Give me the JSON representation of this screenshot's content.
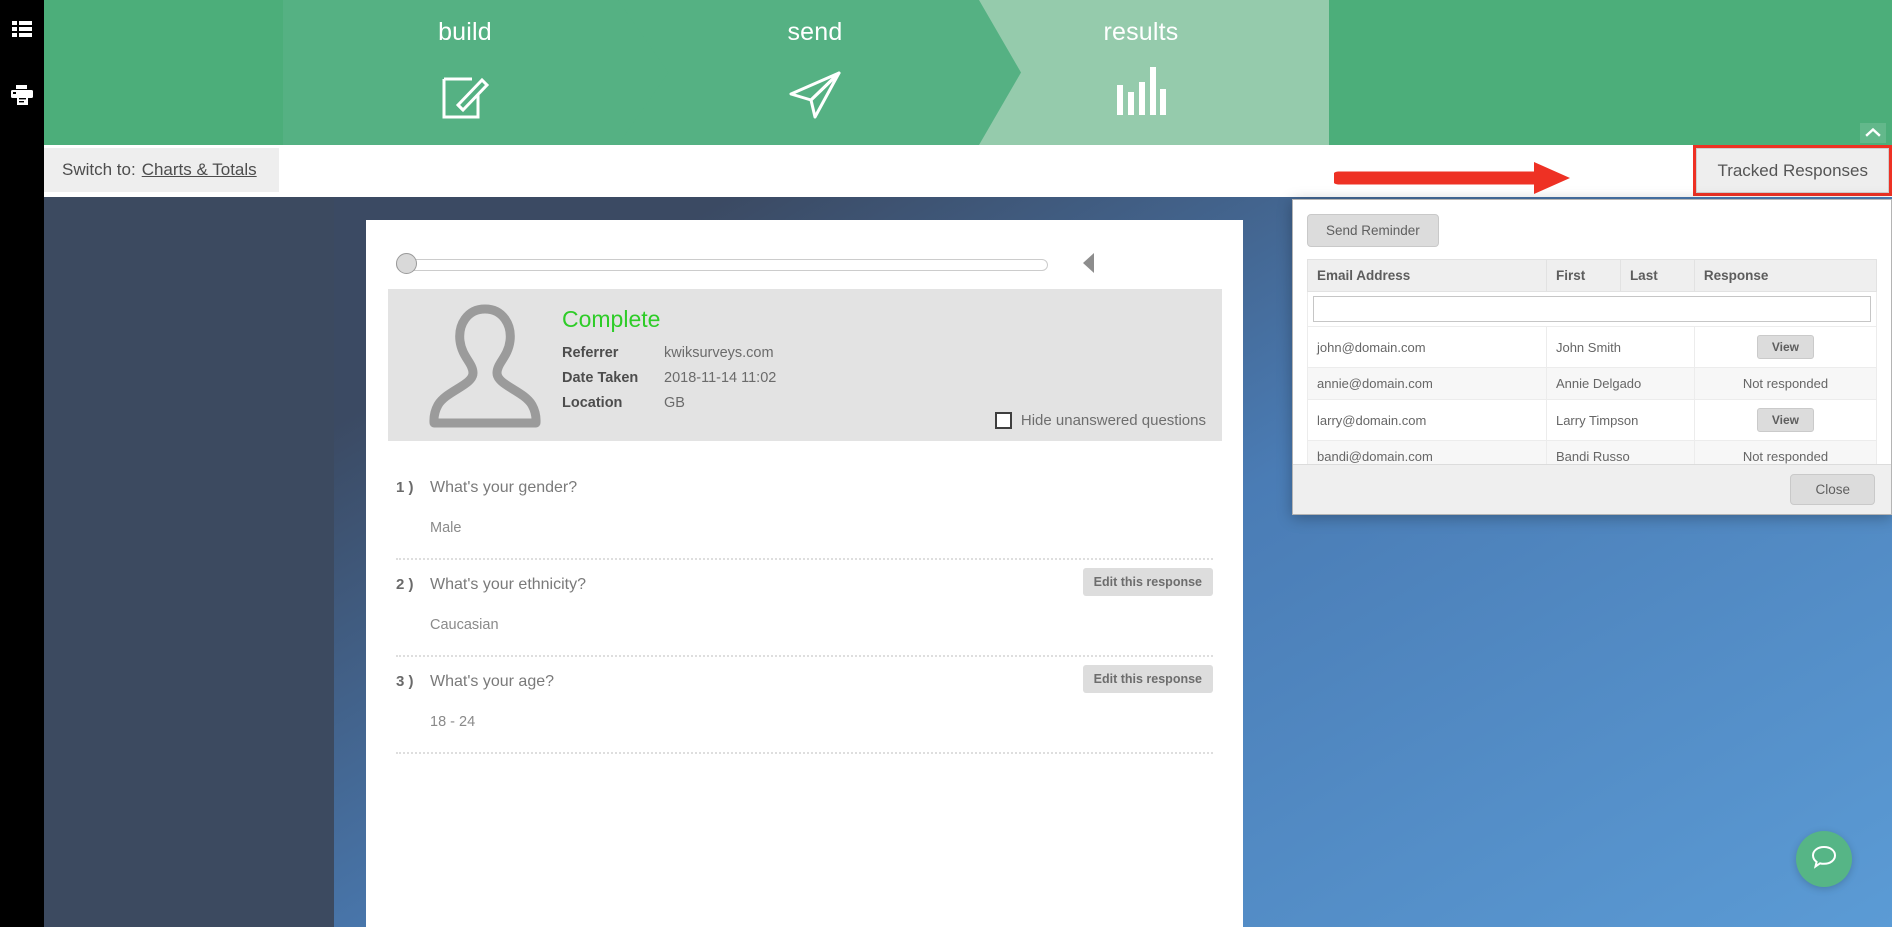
{
  "rail": {
    "items": [
      {
        "icon": "list-view-icon",
        "name": "list-view"
      },
      {
        "icon": "printer-icon",
        "name": "print"
      }
    ]
  },
  "header": {
    "steps": [
      {
        "label": "build",
        "icon": "document-pencil-icon",
        "active": false
      },
      {
        "label": "send",
        "icon": "paper-plane-icon",
        "active": false
      },
      {
        "label": "results",
        "icon": "bar-chart-icon",
        "active": true
      }
    ],
    "collapse_icon": "chevron-up-icon",
    "colors": {
      "bar": "#4cae7a",
      "step": "#55b183",
      "active_step": "#95cbac"
    }
  },
  "toolbar": {
    "switch_prefix": "Switch to:",
    "switch_link": "Charts & Totals",
    "tracked_responses_label": "Tracked Responses",
    "highlight_color": "#ee3124"
  },
  "response": {
    "status": "Complete",
    "status_color": "#2ecc28",
    "fields": [
      {
        "key": "Referrer",
        "value": "kwiksurveys.com"
      },
      {
        "key": "Date Taken",
        "value": "2018-11-14 11:02"
      },
      {
        "key": "Location",
        "value": "GB"
      }
    ],
    "hide_unanswered_label": "Hide unanswered questions",
    "hide_unanswered_checked": false,
    "avatar_icon": "person-silhouette-icon",
    "prev_icon": "chevron-left-icon"
  },
  "questions": [
    {
      "num": "1 )",
      "text": "What's your gender?",
      "answer": "Male",
      "edit_label": "",
      "has_edit": false
    },
    {
      "num": "2 )",
      "text": "What's your ethnicity?",
      "answer": "Caucasian",
      "edit_label": "Edit this response",
      "has_edit": true
    },
    {
      "num": "3 )",
      "text": "What's your age?",
      "answer": "18 - 24",
      "edit_label": "Edit this response",
      "has_edit": true
    }
  ],
  "tracked_modal": {
    "send_reminder_label": "Send Reminder",
    "close_label": "Close",
    "filter_value": "",
    "filter_placeholder": "",
    "columns": [
      "Email Address",
      "First",
      "Last",
      "Response"
    ],
    "rows": [
      {
        "email": "john@domain.com",
        "name": "John Smith",
        "response": "View",
        "is_button": true
      },
      {
        "email": "annie@domain.com",
        "name": "Annie Delgado",
        "response": "Not responded",
        "is_button": false
      },
      {
        "email": "larry@domain.com",
        "name": "Larry Timpson",
        "response": "View",
        "is_button": true
      },
      {
        "email": "bandi@domain.com",
        "name": "Bandi Russo",
        "response": "Not responded",
        "is_button": false
      }
    ]
  },
  "help": {
    "icon": "chat-bubble-icon"
  }
}
